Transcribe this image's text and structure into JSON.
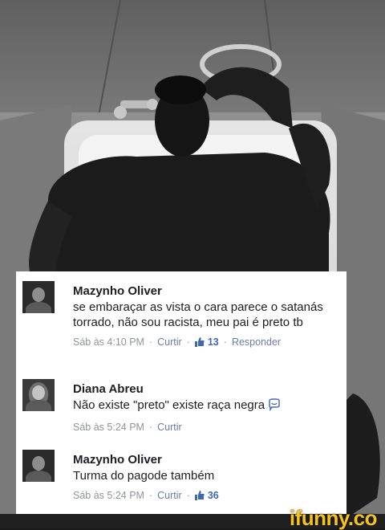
{
  "comments": [
    {
      "author": "Mazynho Oliver",
      "text": "se embaraçar as vista o cara parece o satanás torrado, não sou racista, meu pai é preto tb",
      "time": "Sáb às 4:10 PM",
      "like_label": "Curtir",
      "likes": "13",
      "reply_label": "Responder"
    },
    {
      "author": "Diana Abreu",
      "text": "Não existe \"preto\" existe raça negra",
      "time": "Sáb às 5:24 PM",
      "like_label": "Curtir"
    },
    {
      "author": "Mazynho Oliver",
      "text": "Turma do pagode também",
      "time": "Sáb às 5:24 PM",
      "like_label": "Curtir",
      "likes": "36"
    }
  ],
  "watermark": "ifunny.co",
  "colors": {
    "link": "#6b7da3",
    "like": "#4267b2",
    "watermark": "#f6c21c"
  },
  "icons": [
    "thumbs-up-icon",
    "smiley-icon"
  ]
}
